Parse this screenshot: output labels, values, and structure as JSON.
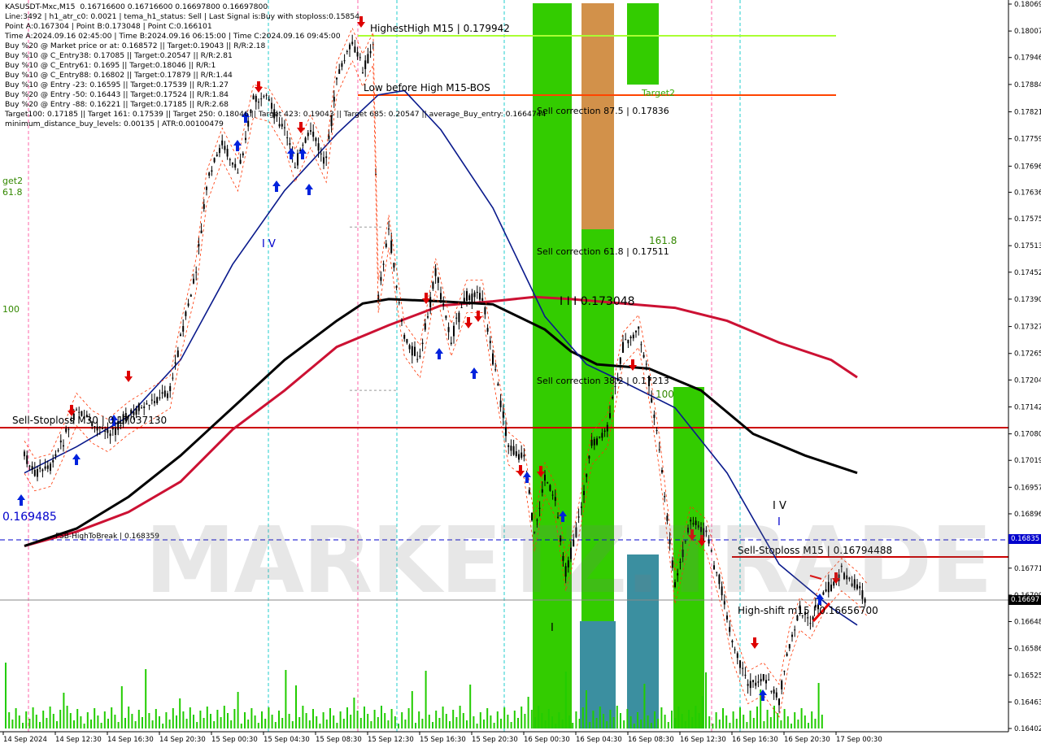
{
  "header_lines": [
    "KASUSDT-Mxc,M15  0.16716600 0.16716600 0.16697800 0.16697800",
    "Line:3492 | h1_atr_c0: 0.0021 | tema_h1_status: Sell | Last Signal is:Buy with stoploss:0.15854",
    "Point A:0.167304 | Point B:0.173048 | Point C:0.166101",
    "Time A:2024.09.16 02:45:00 | Time B:2024.09.16 06:15:00 | Time C:2024.09.16 09:45:00",
    "Buy %20 @ Market price or at: 0.168572 || Target:0.19043 || R/R:2.18",
    "Buy %10 @ C_Entry38: 0.17085 || Target:0.20547 || R/R:2.81",
    "Buy %10 @ C_Entry61: 0.1695 || Target:0.18046 || R/R:1",
    "Buy %10 @ C_Entry88: 0.16802 || Target:0.17879 || R/R:1.44",
    "Buy %10 @ Entry -23: 0.16595 || Target:0.17539 || R/R:1.27",
    "Buy %20 @ Entry -50: 0.16443 || Target:0.17524 || R/R:1.84",
    "Buy %20 @ Entry -88: 0.16221 || Target:0.17185 || R/R:2.68",
    "Target100: 0.17185 || Target 161: 0.17539 || Target 250: 0.18046 || Target 423: 0.19043 || Target 685: 0.20547 || average_Buy_entry: 0.1664744",
    "minimum_distance_buy_levels: 0.00135 | ATR:0.00100479"
  ],
  "watermark": "MARKETZ.TRADE",
  "annotations": {
    "highest_high": "HighestHigh   M15 | 0.179942",
    "low_before_high": "Low before High   M15-BOS",
    "target2": "Target2",
    "sell_corr_875": "Sell correction 87.5 | 0.17836",
    "sell_corr_618": "Sell correction 61.8 | 0.17511",
    "sell_corr_382": "Sell correction 38.2 | 0.17213",
    "fib_1618": "161.8",
    "fib_100": "100",
    "point_b_label": "I I I  0.173048",
    "wave_iv_left": "I V",
    "wave_iv_right": "I V",
    "wave_i_right": "I",
    "wave_i_bottom": "I",
    "sell_stoploss_left": "Sell-Stoploss M30 | 0.17037130",
    "sell_stoploss_right": "Sell-Stoploss M15 | 0.16794488",
    "high_shift": "High-shift m15 | 0.16656700",
    "fsb": "FSB-HighToBreak | 0.168359",
    "low_value": "0.169485",
    "left_target2": "get2",
    "left_1618": "61.8",
    "left_100": "100"
  },
  "highlighted_prices": {
    "fsb_box": "0.16835",
    "current_box": "0.16697",
    "fsb_color": "#0000cc",
    "current_color": "#000000"
  },
  "colors": {
    "ma_black": "#000000",
    "ma_crimson": "#cc1133",
    "ma_navy": "#0a1a8c",
    "sell_line": "#cc0000",
    "fsb_line": "#0000cc",
    "highest_line": "#aaff33",
    "bos_line": "#ff4400",
    "green_zone": "#33cc00",
    "orange_zone": "#d2914a",
    "teal_zone": "#3b8fa0",
    "volume": "#22cc00",
    "up_arrow": "#0022dd",
    "down_arrow": "#dd0000"
  },
  "chart_data": {
    "type": "line",
    "symbol": "KASUSDT-Mxc",
    "timeframe": "M15",
    "ylim": [
      0.16402,
      0.18069
    ],
    "y_ticks": [
      "0.18069",
      "0.18007",
      "0.17946",
      "0.17884",
      "0.17821",
      "0.17759",
      "0.17696",
      "0.17636",
      "0.17575",
      "0.17513",
      "0.17452",
      "0.17390",
      "0.17327",
      "0.17265",
      "0.17204",
      "0.17142",
      "0.17080",
      "0.17019",
      "0.16957",
      "0.16896",
      "0.16835",
      "0.16771",
      "0.16709",
      "0.16648",
      "0.16586",
      "0.16525",
      "0.16463",
      "0.16402"
    ],
    "x_ticks": [
      "14 Sep 2024",
      "14 Sep 12:30",
      "14 Sep 16:30",
      "14 Sep 20:30",
      "15 Sep 00:30",
      "15 Sep 04:30",
      "15 Sep 08:30",
      "15 Sep 12:30",
      "15 Sep 16:30",
      "15 Sep 20:30",
      "16 Sep 00:30",
      "16 Sep 04:30",
      "16 Sep 08:30",
      "16 Sep 12:30",
      "16 Sep 16:30",
      "16 Sep 20:30",
      "17 Sep 00:30"
    ],
    "price_path": [
      [
        0,
        0.1703
      ],
      [
        0.2,
        0.1699
      ],
      [
        0.5,
        0.17
      ],
      [
        0.8,
        0.1708
      ],
      [
        1.0,
        0.1714
      ],
      [
        1.3,
        0.171
      ],
      [
        1.6,
        0.1708
      ],
      [
        2.0,
        0.1712
      ],
      [
        2.4,
        0.1715
      ],
      [
        2.8,
        0.1718
      ],
      [
        3.0,
        0.173
      ],
      [
        3.3,
        0.1745
      ],
      [
        3.5,
        0.1765
      ],
      [
        3.8,
        0.1775
      ],
      [
        4.1,
        0.1768
      ],
      [
        4.4,
        0.1785
      ],
      [
        4.7,
        0.1784
      ],
      [
        5.0,
        0.1778
      ],
      [
        5.2,
        0.177
      ],
      [
        5.5,
        0.1778
      ],
      [
        5.8,
        0.177
      ],
      [
        6.0,
        0.179
      ],
      [
        6.3,
        0.1798
      ],
      [
        6.5,
        0.1792
      ],
      [
        6.7,
        0.1797
      ],
      [
        6.8,
        0.174
      ],
      [
        7.0,
        0.1755
      ],
      [
        7.3,
        0.173
      ],
      [
        7.6,
        0.1725
      ],
      [
        7.9,
        0.1745
      ],
      [
        8.2,
        0.173
      ],
      [
        8.5,
        0.174
      ],
      [
        8.8,
        0.174
      ],
      [
        9.0,
        0.1725
      ],
      [
        9.3,
        0.1705
      ],
      [
        9.6,
        0.1702
      ],
      [
        9.8,
        0.1685
      ],
      [
        10.0,
        0.1698
      ],
      [
        10.2,
        0.1693
      ],
      [
        10.4,
        0.1676
      ],
      [
        10.6,
        0.1685
      ],
      [
        10.9,
        0.1705
      ],
      [
        11.2,
        0.1709
      ],
      [
        11.5,
        0.1728
      ],
      [
        11.8,
        0.1732
      ],
      [
        12.0,
        0.172
      ],
      [
        12.2,
        0.1704
      ],
      [
        12.5,
        0.1673
      ],
      [
        12.8,
        0.1688
      ],
      [
        13.1,
        0.1685
      ],
      [
        13.4,
        0.1672
      ],
      [
        13.6,
        0.166
      ],
      [
        13.9,
        0.165
      ],
      [
        14.2,
        0.1652
      ],
      [
        14.5,
        0.1647
      ],
      [
        14.7,
        0.166
      ],
      [
        14.9,
        0.1667
      ],
      [
        15.1,
        0.1665
      ],
      [
        15.4,
        0.1672
      ],
      [
        15.7,
        0.1676
      ],
      [
        16.0,
        0.1673
      ],
      [
        16.2,
        0.167
      ]
    ],
    "ma_slow_black": [
      [
        0,
        0.16822
      ],
      [
        1,
        0.16862
      ],
      [
        2,
        0.16935
      ],
      [
        3,
        0.1703
      ],
      [
        4,
        0.1714
      ],
      [
        5,
        0.1725
      ],
      [
        6,
        0.1734
      ],
      [
        6.5,
        0.1738
      ],
      [
        7,
        0.1739
      ],
      [
        8,
        0.17385
      ],
      [
        9,
        0.17378
      ],
      [
        10,
        0.1732
      ],
      [
        10.5,
        0.1727
      ],
      [
        11,
        0.1724
      ],
      [
        12,
        0.1723
      ],
      [
        13,
        0.1718
      ],
      [
        14,
        0.1708
      ],
      [
        15,
        0.1703
      ],
      [
        16,
        0.1699
      ]
    ],
    "ma_mid_crimson": [
      [
        0,
        0.16822
      ],
      [
        1,
        0.16855
      ],
      [
        2,
        0.169
      ],
      [
        3,
        0.1697
      ],
      [
        4,
        0.1709
      ],
      [
        5,
        0.1718
      ],
      [
        6,
        0.1728
      ],
      [
        7,
        0.1733
      ],
      [
        8,
        0.17375
      ],
      [
        9,
        0.17385
      ],
      [
        9.8,
        0.17395
      ],
      [
        10.5,
        0.1739
      ],
      [
        11.5,
        0.1738
      ],
      [
        12.5,
        0.1737
      ],
      [
        13.5,
        0.1734
      ],
      [
        14.5,
        0.1729
      ],
      [
        15.5,
        0.1725
      ],
      [
        16,
        0.1721
      ]
    ],
    "ma_fast_navy": [
      [
        0,
        0.1699
      ],
      [
        1,
        0.1705
      ],
      [
        2,
        0.1712
      ],
      [
        3,
        0.1725
      ],
      [
        4,
        0.1747
      ],
      [
        5,
        0.1764
      ],
      [
        6,
        0.1777
      ],
      [
        6.8,
        0.1786
      ],
      [
        7.3,
        0.1787
      ],
      [
        8,
        0.1778
      ],
      [
        9,
        0.176
      ],
      [
        10,
        0.1735
      ],
      [
        10.8,
        0.1724
      ],
      [
        11.5,
        0.172
      ],
      [
        12.5,
        0.1714
      ],
      [
        13.5,
        0.1699
      ],
      [
        14.5,
        0.1678
      ],
      [
        15.5,
        0.1668
      ],
      [
        16,
        0.1664
      ]
    ],
    "levels": [
      {
        "name": "HighestHigh M15",
        "value": 0.179942
      },
      {
        "name": "Low before High M15-BOS",
        "value": 0.17856
      },
      {
        "name": "Sell-Stoploss M30",
        "value": 0.171
      },
      {
        "name": "Sell-Stoploss M15",
        "value": 0.16794488
      },
      {
        "name": "FSB-HighToBreak",
        "value": 0.168359
      },
      {
        "name": "current",
        "value": 0.16697
      }
    ]
  }
}
